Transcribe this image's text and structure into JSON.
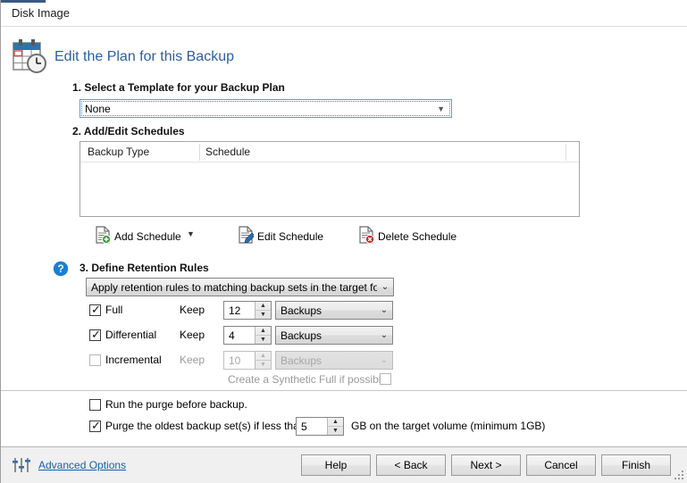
{
  "window": {
    "title": "Disk Image"
  },
  "header": {
    "icon": "calendar-clock-icon",
    "title": "Edit the Plan for this Backup"
  },
  "step1": {
    "label": "1. Select a Template for your Backup Plan",
    "template_select": {
      "value": "None",
      "arrow": "▼"
    }
  },
  "step2": {
    "label": "2. Add/Edit Schedules",
    "table": {
      "columns": [
        "Backup Type",
        "Schedule"
      ],
      "rows": []
    },
    "buttons": {
      "add": "Add Schedule",
      "add_dropdown_arrow": "▼",
      "edit": "Edit Schedule",
      "delete": "Delete Schedule"
    }
  },
  "step3": {
    "help_icon": "help-circle-icon",
    "label": "3. Define Retention Rules",
    "scope_select": {
      "value": "Apply retention rules to matching backup sets in the target folder",
      "arrow": "⌄"
    },
    "rows": [
      {
        "name": "Full",
        "checked": true,
        "enabled": true,
        "keep_label": "Keep",
        "count": "12",
        "unit": "Backups"
      },
      {
        "name": "Differential",
        "checked": true,
        "enabled": true,
        "keep_label": "Keep",
        "count": "4",
        "unit": "Backups"
      },
      {
        "name": "Incremental",
        "checked": false,
        "enabled": false,
        "keep_label": "Keep",
        "count": "10",
        "unit": "Backups"
      }
    ],
    "synthetic_full": {
      "label": "Create a Synthetic Full if possible",
      "checked": false,
      "enabled": false
    }
  },
  "purge": {
    "run_before": {
      "label": "Run the purge before backup.",
      "checked": false
    },
    "oldest": {
      "label": "Purge the oldest backup set(s) if less than",
      "checked": true,
      "value": "5",
      "suffix": "GB on the target volume (minimum 1GB)"
    }
  },
  "footer": {
    "advanced_icon": "sliders-icon",
    "advanced_label": "Advanced Options",
    "buttons": [
      {
        "label": "Help"
      },
      {
        "label": "< Back"
      },
      {
        "label": "Next >"
      },
      {
        "label": "Cancel"
      },
      {
        "label": "Finish"
      }
    ]
  },
  "colors": {
    "accent_blue": "#2c5f9e",
    "link_blue": "#1560a8",
    "calendar_blue": "#2f72ad",
    "add_green": "#3d9e3d",
    "delete_red": "#cc2b2b",
    "edit_blue": "#2b6cb0"
  }
}
